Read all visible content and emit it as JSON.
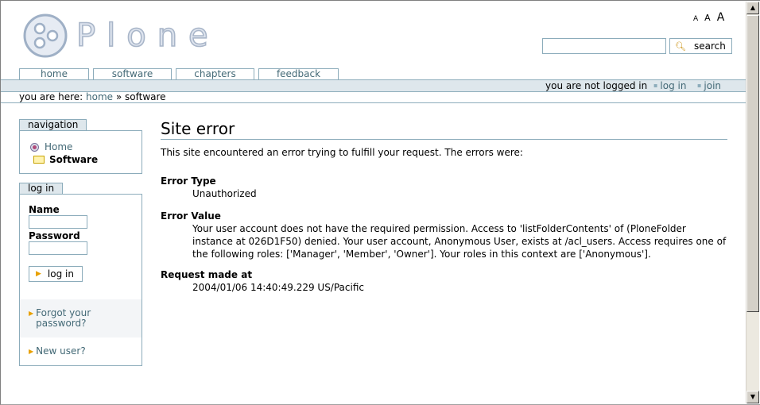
{
  "site": {
    "logo_text": "Plone"
  },
  "textsize": {
    "small": "A",
    "medium": "A",
    "large": "A"
  },
  "search": {
    "placeholder": "",
    "button_label": "search"
  },
  "tabs": [
    {
      "label": "home"
    },
    {
      "label": "software"
    },
    {
      "label": "chapters"
    },
    {
      "label": "feedback"
    }
  ],
  "personal_bar": {
    "status": "you are not logged in",
    "login_label": "log in",
    "join_label": "join"
  },
  "breadcrumbs": {
    "prefix": "you are here:",
    "home": "home",
    "separator": "»",
    "current": "software"
  },
  "navigation": {
    "title": "navigation",
    "items": [
      {
        "label": "Home",
        "icon": "plone-home-icon"
      },
      {
        "label": "Software",
        "icon": "folder-icon"
      }
    ]
  },
  "login": {
    "title": "log in",
    "name_label": "Name",
    "password_label": "Password",
    "button_label": "log in",
    "forgot_label": "Forgot your password?",
    "new_user_label": "New user?"
  },
  "error": {
    "title": "Site error",
    "intro": "This site encountered an error trying to fulfill your request. The errors were:",
    "type_label": "Error Type",
    "type_value": "Unauthorized",
    "value_label": "Error Value",
    "value_text": "Your user account does not have the required permission. Access to 'listFolderContents' of (PloneFolder instance at 026D1F50) denied. Your user account, Anonymous User, exists at /acl_users. Access requires one of the following roles: ['Manager', 'Member', 'Owner']. Your roles in this context are ['Anonymous'].",
    "request_label": "Request made at",
    "request_value": "2004/01/06 14:40:49.229 US/Pacific"
  },
  "colors": {
    "accent": "#436976",
    "border": "#8cacbb",
    "bar_bg": "#dee7ec"
  }
}
